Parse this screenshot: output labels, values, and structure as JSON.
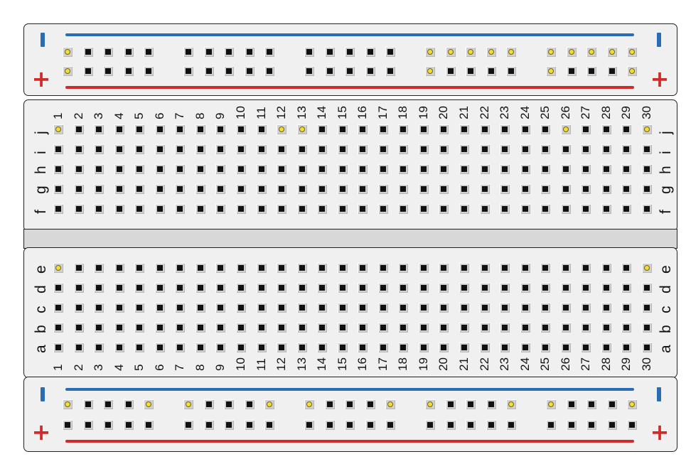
{
  "colors": {
    "negative_rail": "#2a6db5",
    "positive_rail": "#d12a2a",
    "board_fill": "#f0f0f0",
    "lit_contact": "#f2dc3b"
  },
  "rails": {
    "minus_symbol": "-",
    "plus_symbol": "+"
  },
  "columns": [
    "1",
    "2",
    "3",
    "4",
    "5",
    "6",
    "7",
    "8",
    "9",
    "10",
    "11",
    "12",
    "13",
    "14",
    "15",
    "16",
    "17",
    "18",
    "19",
    "20",
    "21",
    "22",
    "23",
    "24",
    "25",
    "26",
    "27",
    "28",
    "29",
    "30"
  ],
  "top_rows": [
    "j",
    "i",
    "h",
    "g",
    "f"
  ],
  "bottom_rows": [
    "e",
    "d",
    "c",
    "b",
    "a"
  ],
  "lit_holes": {
    "top_rail_negative": [
      1,
      16,
      17,
      18,
      19,
      20,
      21,
      22,
      23,
      24,
      25
    ],
    "top_rail_positive": [
      1,
      16,
      21,
      25
    ],
    "bottom_rail_negative": [
      1,
      5,
      6,
      10,
      11,
      15,
      16,
      20,
      21,
      25
    ],
    "bottom_rail_positive": [],
    "terminal": [
      {
        "row": "j",
        "col": 1
      },
      {
        "row": "j",
        "col": 12
      },
      {
        "row": "j",
        "col": 13
      },
      {
        "row": "j",
        "col": 26
      },
      {
        "row": "j",
        "col": 30
      },
      {
        "row": "e",
        "col": 1
      },
      {
        "row": "e",
        "col": 30
      }
    ]
  }
}
